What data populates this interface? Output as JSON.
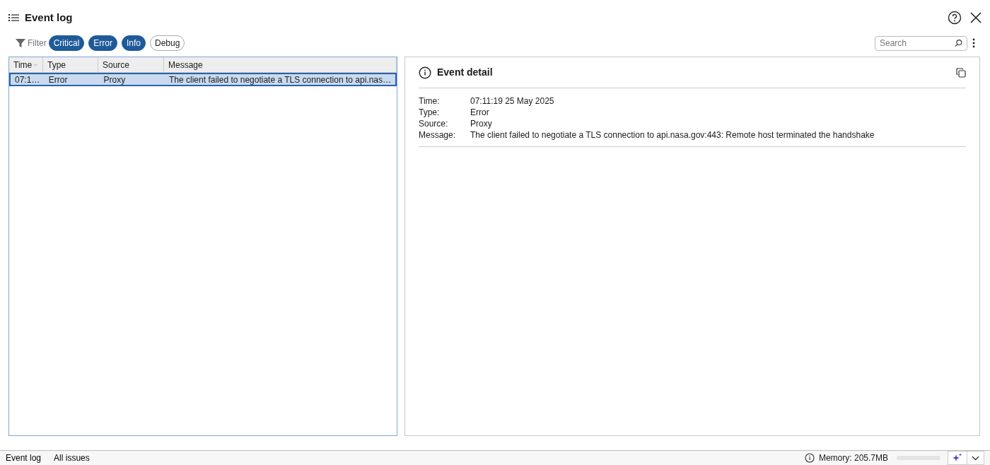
{
  "window": {
    "title": "Event log"
  },
  "filter": {
    "label": "Filter",
    "chips": [
      {
        "label": "Critical",
        "selected": true
      },
      {
        "label": "Error",
        "selected": true
      },
      {
        "label": "Info",
        "selected": true
      },
      {
        "label": "Debug",
        "selected": false
      }
    ]
  },
  "search": {
    "placeholder": "Search"
  },
  "table": {
    "columns": [
      {
        "label": "Time",
        "sorted": true
      },
      {
        "label": "Type",
        "sorted": false
      },
      {
        "label": "Source",
        "sorted": false
      },
      {
        "label": "Message",
        "sorted": false
      }
    ],
    "rows": [
      {
        "selected": true,
        "cells": [
          "07:1…",
          "Error",
          "Proxy",
          "The client failed to negotiate a TLS connection to api.nas…"
        ]
      }
    ]
  },
  "detail": {
    "title": "Event detail",
    "fields": [
      {
        "label": "Time:",
        "value": "07:11:19 25 May 2025"
      },
      {
        "label": "Type:",
        "value": "Error"
      },
      {
        "label": "Source:",
        "value": "Proxy"
      },
      {
        "label": "Message:",
        "value": "The client failed to negotiate a TLS connection to api.nasa.gov:443: Remote host terminated the handshake"
      }
    ]
  },
  "status_bar": {
    "tabs": [
      "Event log",
      "All issues"
    ],
    "memory": {
      "text": "Memory: 205.7MB"
    }
  }
}
